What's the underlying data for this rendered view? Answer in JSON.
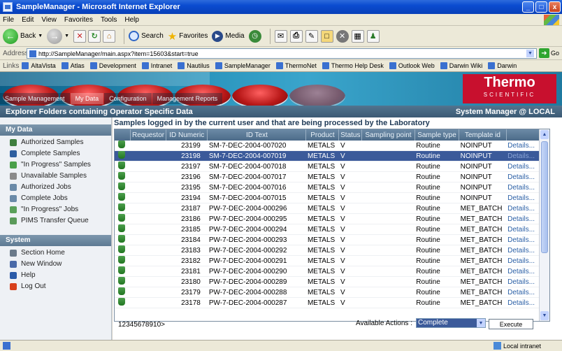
{
  "window": {
    "title": "SampleManager - Microsoft Internet Explorer",
    "controls": [
      "_",
      "□",
      "x"
    ]
  },
  "menu": [
    "File",
    "Edit",
    "View",
    "Favorites",
    "Tools",
    "Help"
  ],
  "toolbar": {
    "back_label": "Back",
    "search_label": "Search",
    "favorites_label": "Favorites",
    "media_label": "Media"
  },
  "address": {
    "label": "Address",
    "url": "http://SampleManager/main.aspx?item=15603&start=true",
    "go_label": "Go"
  },
  "links": {
    "label": "Links",
    "items": [
      "AltaVista",
      "Atlas",
      "Development",
      "Intranet",
      "Nautilus",
      "SampleManager",
      "ThermoNet",
      "Thermo Help Desk",
      "Outlook Web",
      "Darwin Wiki",
      "Darwin"
    ]
  },
  "brand": {
    "logo_main": "Thermo",
    "logo_sub": "SCIENTIFIC",
    "logo_color": "#c8102e"
  },
  "nav_tabs": [
    "Sample Management",
    "My Data",
    "Configuration",
    "Management Reports"
  ],
  "header": {
    "title": "Explorer Folders containing Operator Specific Data",
    "context": "System Manager @ LOCAL"
  },
  "sidebar": {
    "my_data_heading": "My Data",
    "my_data_items": [
      {
        "label": "Authorized Samples",
        "color": "#3f7f3f"
      },
      {
        "label": "Complete Samples",
        "color": "#2f5f9f"
      },
      {
        "label": "\"In Progress\" Samples",
        "color": "#4aa04a"
      },
      {
        "label": "Unavailable Samples",
        "color": "#8a8a8a"
      },
      {
        "label": "Authorized Jobs",
        "color": "#6a8aa8"
      },
      {
        "label": "Complete Jobs",
        "color": "#6a8aa8"
      },
      {
        "label": "\"In Progress\" Jobs",
        "color": "#5aa05a"
      },
      {
        "label": "PIMS Transfer Queue",
        "color": "#5a9a5a"
      }
    ],
    "system_heading": "System",
    "system_items": [
      {
        "label": "Section Home",
        "color": "#6a7a8a"
      },
      {
        "label": "New Window",
        "color": "#4a6aa8"
      },
      {
        "label": "Help",
        "color": "#2a5aa8"
      },
      {
        "label": "Log Out",
        "color": "#d8401c"
      }
    ]
  },
  "main": {
    "table_title": "Samples logged in by the current user and that are being processed by the Laboratory",
    "columns": [
      "",
      "Requestor",
      "ID Numeric",
      "ID Text",
      "Product",
      "Status",
      "Sampling point",
      "Sample type",
      "Template id",
      ""
    ],
    "rows": [
      {
        "id": "23199",
        "text": "SM-7-DEC-2004-007020",
        "product": "METALS",
        "status": "V",
        "type": "Routine",
        "template": "NOINPUT",
        "link": "Details...",
        "selected": false
      },
      {
        "id": "23198",
        "text": "SM-7-DEC-2004-007019",
        "product": "METALS",
        "status": "V",
        "type": "Routine",
        "template": "NOINPUT",
        "link": "Details...",
        "selected": true
      },
      {
        "id": "23197",
        "text": "SM-7-DEC-2004-007018",
        "product": "METALS",
        "status": "V",
        "type": "Routine",
        "template": "NOINPUT",
        "link": "Details...",
        "selected": false
      },
      {
        "id": "23196",
        "text": "SM-7-DEC-2004-007017",
        "product": "METALS",
        "status": "V",
        "type": "Routine",
        "template": "NOINPUT",
        "link": "Details...",
        "selected": false
      },
      {
        "id": "23195",
        "text": "SM-7-DEC-2004-007016",
        "product": "METALS",
        "status": "V",
        "type": "Routine",
        "template": "NOINPUT",
        "link": "Details...",
        "selected": false
      },
      {
        "id": "23194",
        "text": "SM-7-DEC-2004-007015",
        "product": "METALS",
        "status": "V",
        "type": "Routine",
        "template": "NOINPUT",
        "link": "Details...",
        "selected": false
      },
      {
        "id": "23187",
        "text": "PW-7-DEC-2004-000296",
        "product": "METALS",
        "status": "V",
        "type": "Routine",
        "template": "MET_BATCH",
        "link": "Details...",
        "selected": false
      },
      {
        "id": "23186",
        "text": "PW-7-DEC-2004-000295",
        "product": "METALS",
        "status": "V",
        "type": "Routine",
        "template": "MET_BATCH",
        "link": "Details...",
        "selected": false
      },
      {
        "id": "23185",
        "text": "PW-7-DEC-2004-000294",
        "product": "METALS",
        "status": "V",
        "type": "Routine",
        "template": "MET_BATCH",
        "link": "Details...",
        "selected": false
      },
      {
        "id": "23184",
        "text": "PW-7-DEC-2004-000293",
        "product": "METALS",
        "status": "V",
        "type": "Routine",
        "template": "MET_BATCH",
        "link": "Details...",
        "selected": false
      },
      {
        "id": "23183",
        "text": "PW-7-DEC-2004-000292",
        "product": "METALS",
        "status": "V",
        "type": "Routine",
        "template": "MET_BATCH",
        "link": "Details...",
        "selected": false
      },
      {
        "id": "23182",
        "text": "PW-7-DEC-2004-000291",
        "product": "METALS",
        "status": "V",
        "type": "Routine",
        "template": "MET_BATCH",
        "link": "Details...",
        "selected": false
      },
      {
        "id": "23181",
        "text": "PW-7-DEC-2004-000290",
        "product": "METALS",
        "status": "V",
        "type": "Routine",
        "template": "MET_BATCH",
        "link": "Details...",
        "selected": false
      },
      {
        "id": "23180",
        "text": "PW-7-DEC-2004-000289",
        "product": "METALS",
        "status": "V",
        "type": "Routine",
        "template": "MET_BATCH",
        "link": "Details...",
        "selected": false
      },
      {
        "id": "23179",
        "text": "PW-7-DEC-2004-000288",
        "product": "METALS",
        "status": "V",
        "type": "Routine",
        "template": "MET_BATCH",
        "link": "Details...",
        "selected": false
      },
      {
        "id": "23178",
        "text": "PW-7-DEC-2004-000287",
        "product": "METALS",
        "status": "V",
        "type": "Routine",
        "template": "MET_BATCH",
        "link": "Details...",
        "selected": false
      }
    ],
    "pager": "12345678910>",
    "actions_label": "Available Actions :",
    "actions_value": "Complete",
    "execute_label": "Execute"
  },
  "status": {
    "zone": "Local intranet"
  }
}
